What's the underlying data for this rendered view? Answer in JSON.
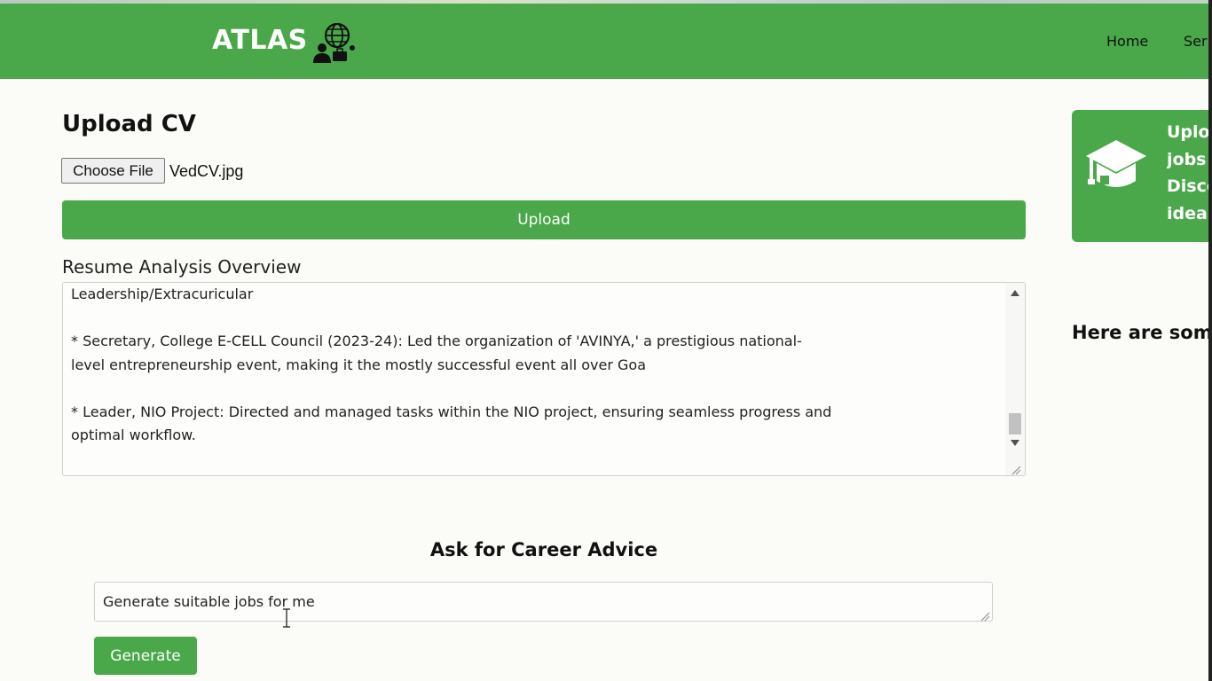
{
  "navbar": {
    "brand": "ATLAS",
    "links": [
      "Home",
      "Ser"
    ]
  },
  "upload": {
    "title": "Upload CV",
    "choose_file_label": "Choose File",
    "file_name": "VedCV.jpg",
    "upload_button": "Upload"
  },
  "analysis": {
    "label": "Resume Analysis Overview",
    "text": "Leadership/Extracuricular\n\n* Secretary, College E-CELL Council (2023-24): Led the organization of 'AVINYA,' a prestigious national-\nlevel entrepreneurship event, making it the mostly successful event all over Goa\n\n* Leader, NIO Project: Directed and managed tasks within the NIO project, ensuring seamless progress and\noptimal workflow."
  },
  "advice": {
    "title": "Ask for Career Advice",
    "input_value": "Generate suitable jobs for me",
    "generate_button": "Generate"
  },
  "side": {
    "card_lines": [
      "Uploa",
      "jobs c",
      "Disco",
      "ideal"
    ],
    "here_text": "Here are some"
  },
  "colors": {
    "brand_green": "#4aa84a",
    "background": "#fbfcf8"
  }
}
